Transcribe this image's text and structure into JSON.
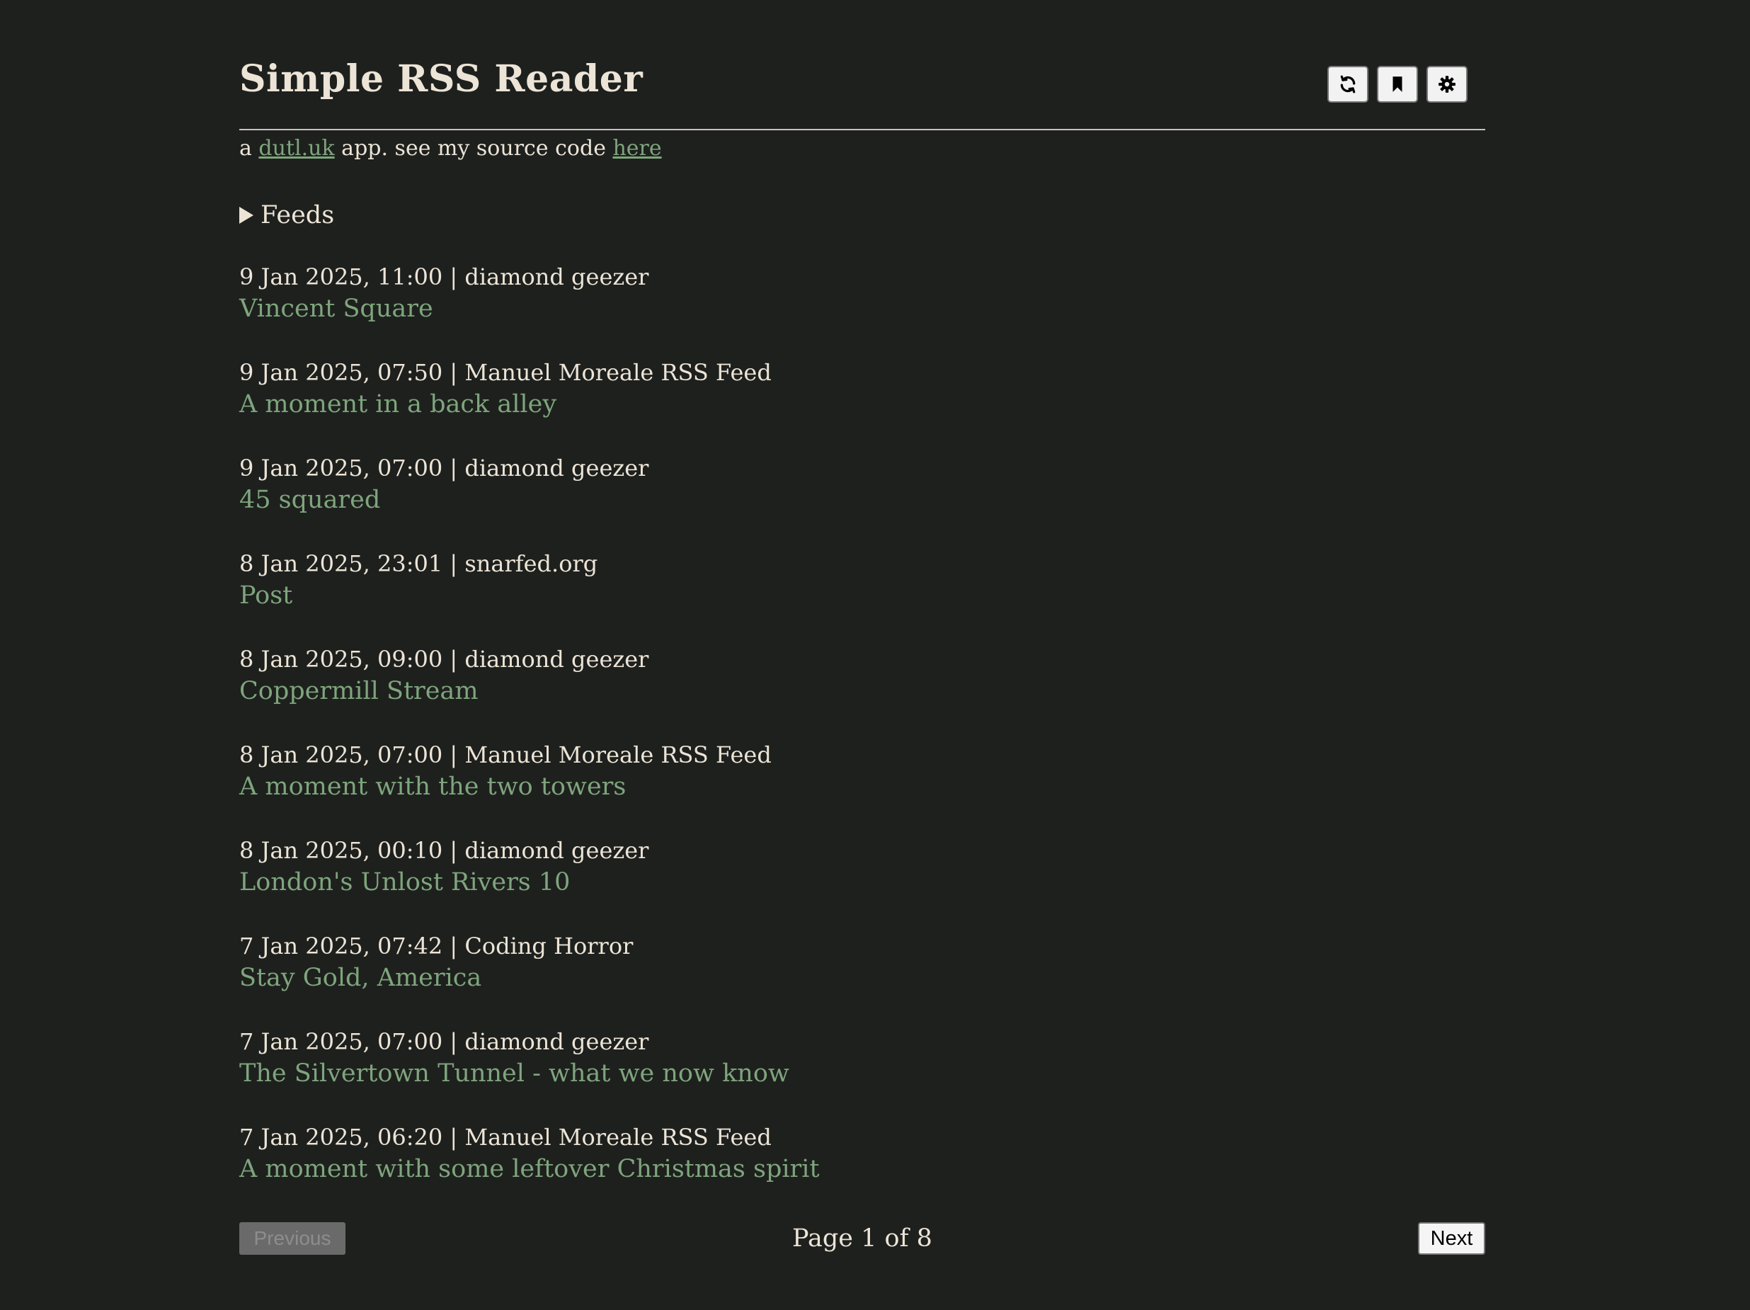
{
  "app": {
    "title": "Simple RSS Reader"
  },
  "toolbar": {
    "buttons": [
      {
        "icon": "refresh-icon"
      },
      {
        "icon": "bookmark-icon"
      },
      {
        "icon": "gear-icon"
      }
    ]
  },
  "subtitle": {
    "prefix": "a ",
    "site_link": "dutl.uk",
    "middle": " app. see my source code ",
    "source_link": "here"
  },
  "feeds": {
    "label": "Feeds"
  },
  "items": [
    {
      "meta": "9 Jan 2025, 11:00 | diamond geezer",
      "title": "Vincent Square"
    },
    {
      "meta": "9 Jan 2025, 07:50 | Manuel Moreale RSS Feed",
      "title": "A moment in a back alley"
    },
    {
      "meta": "9 Jan 2025, 07:00 | diamond geezer",
      "title": "45 squared"
    },
    {
      "meta": "8 Jan 2025, 23:01 | snarfed.org",
      "title": "Post"
    },
    {
      "meta": "8 Jan 2025, 09:00 | diamond geezer",
      "title": "Coppermill Stream"
    },
    {
      "meta": "8 Jan 2025, 07:00 | Manuel Moreale RSS Feed",
      "title": "A moment with the two towers"
    },
    {
      "meta": "8 Jan 2025, 00:10 | diamond geezer",
      "title": "London's Unlost Rivers 10"
    },
    {
      "meta": "7 Jan 2025, 07:42 | Coding Horror",
      "title": "Stay Gold, America"
    },
    {
      "meta": "7 Jan 2025, 07:00 | diamond geezer",
      "title": "The Silvertown Tunnel - what we now know"
    },
    {
      "meta": "7 Jan 2025, 06:20 | Manuel Moreale RSS Feed",
      "title": "A moment with some leftover Christmas spirit"
    }
  ],
  "pager": {
    "previous_label": "Previous",
    "page_info": "Page 1 of 8",
    "next_label": "Next"
  },
  "colors": {
    "background": "#1e201e",
    "text": "#ece4d6",
    "link": "#7ea57c"
  }
}
